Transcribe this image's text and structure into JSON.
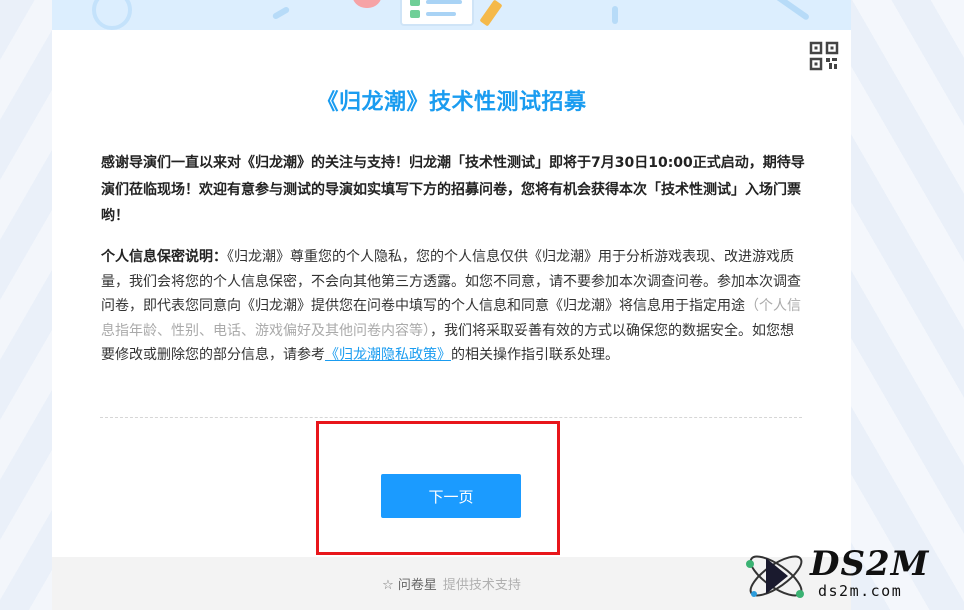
{
  "page": {
    "title": "《归龙潮》技术性测试招募",
    "intro": "感谢导演们一直以来对《归龙潮》的关注与支持！归龙潮「技术性测试」即将于7月30日10:00正式启动，期待导演们莅临现场！欢迎有意参与测试的导演如实填写下方的招募问卷，您将有机会获得本次「技术性测试」入场门票哟！",
    "privacy": {
      "lead": "个人信息保密说明：",
      "body1": "《归龙潮》尊重您的个人隐私，您的个人信息仅供《归龙潮》用于分析游戏表现、改进游戏质量，我们会将您的个人信息保密，不会向其他第三方透露。如您不同意，请不要参加本次调查问卷。参加本次调查问卷，即代表您同意向《归龙潮》提供您在问卷中填写的个人信息和同意《归龙潮》将信息用于指定用途",
      "muted": "（个人信息指年龄、性别、电话、游戏偏好及其他问卷内容等）",
      "body2": "，我们将采取妥善有效的方式以确保您的数据安全。如您想要修改或删除您的部分信息，请参考",
      "link": "《归龙潮隐私政策》",
      "body3": "的相关操作指引联系处理。"
    },
    "next_button": "下一页",
    "qr_icon": "qr-code-icon"
  },
  "footer": {
    "star_icon": "star-icon",
    "brand": "问卷星",
    "support": "提供技术支持"
  },
  "watermark": {
    "main": "DS2M",
    "sub": "ds2m.com"
  },
  "colors": {
    "accent": "#1a9cf0",
    "button": "#1b9bff",
    "highlight": "#e8161b"
  }
}
